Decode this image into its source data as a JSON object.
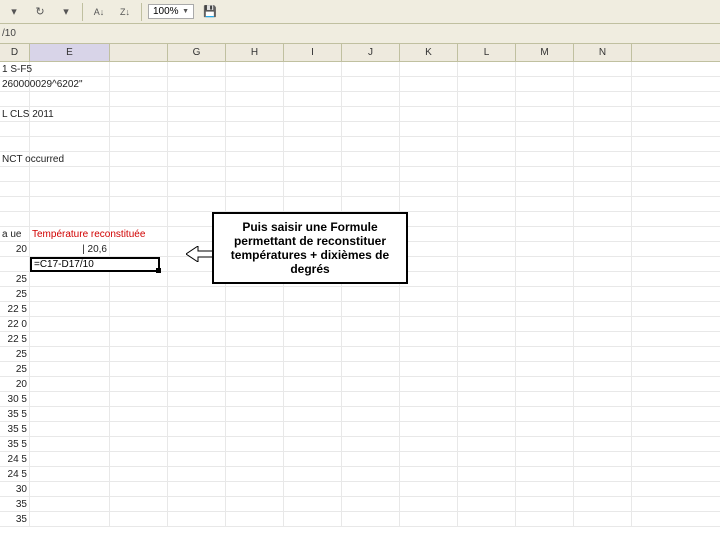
{
  "toolbar": {
    "zoom": "100%"
  },
  "formula_bar": "/10",
  "columns": {
    "left": "D",
    "e": "E",
    "g": "G",
    "h": "H",
    "i": "I",
    "j": "J",
    "k": "K",
    "l": "L",
    "m": "M",
    "n": "N"
  },
  "rows": {
    "r1": "1 S-F5",
    "r2": "260000029^6202\"",
    "r4": "L CLS 2011",
    "r10": "NCT occurred",
    "r14_d": "a ue",
    "r14_e": "Température reconstituée",
    "r15_d": "20",
    "r15_e": "| 20,6",
    "r16": "=C17-D17/10",
    "vals": [
      "25",
      "25",
      "22 5",
      "22 0",
      "22 5",
      "25",
      "25",
      "20",
      "30 5",
      "35 5",
      "35 5",
      "35 5",
      "24 5",
      "24 5",
      "30",
      "35",
      "35"
    ]
  },
  "callout": {
    "l1": "Puis saisir une Formule",
    "l2": "permettant de reconstituer",
    "l3": "températures + dixièmes de",
    "l4": "degrés"
  }
}
